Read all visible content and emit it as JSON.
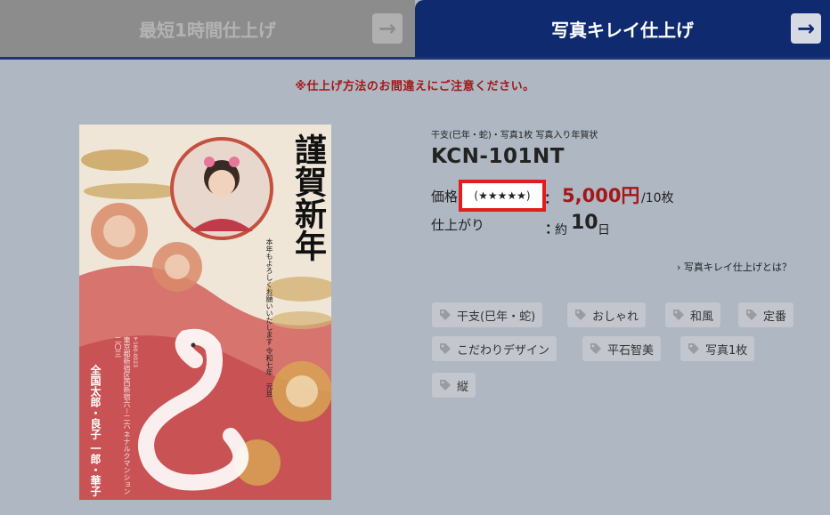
{
  "tabs": {
    "left": {
      "label": "最短1時間仕上げ",
      "arrow": "→"
    },
    "right": {
      "label": "写真キレイ仕上げ",
      "arrow": "→"
    }
  },
  "notice": "※仕上げ方法のお間違えにご注意ください。",
  "card": {
    "greeting": "謹賀新年",
    "message": [
      "本年もよろしくお願いいたします",
      "令和七年　元旦"
    ],
    "postal": "〒160-0023",
    "address": [
      "東京都新宿区西新宿六－二六",
      "ネナルクマンション二〇三"
    ],
    "names": [
      "全国太郎・良子",
      "一郎・華子"
    ]
  },
  "product": {
    "category": "干支(巳年・蛇)・写真1枚 写真入り年賀状",
    "model": "KCN-101NT",
    "price_label": "価格",
    "stars": "(★★★★★)",
    "colon": "：",
    "price": "5,000円",
    "price_unit": "/10枚",
    "finish_label": "仕上がり",
    "finish_prefix": "約",
    "finish_days": "10",
    "finish_suffix": "日",
    "about_link": "写真キレイ仕上げとは？"
  },
  "tags": [
    "干支(巳年・蛇)",
    "おしゃれ",
    "和風",
    "定番",
    "こだわりデザイン",
    "平石智美",
    "写真1枚",
    "縦"
  ],
  "colors": {
    "accent_red": "#a31818",
    "highlight_red": "#e31c1c",
    "tab_active": "#0f2a6e",
    "tab_inactive": "#8c8c8c",
    "background": "#aeb7c2"
  }
}
